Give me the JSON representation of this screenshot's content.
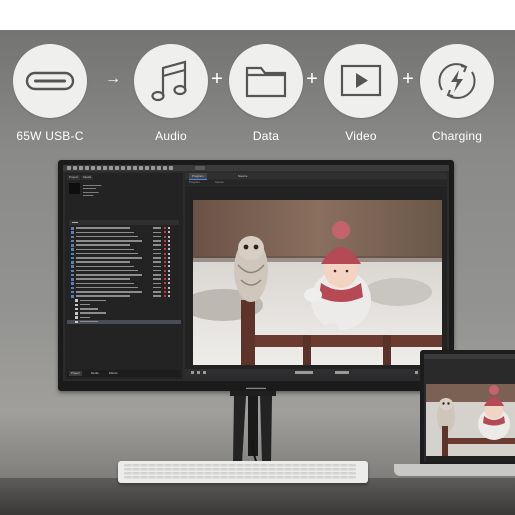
{
  "features": [
    {
      "label": "65W USB-C",
      "icon": "usb-c-port-icon"
    },
    {
      "label": "Audio",
      "icon": "music-notes-icon"
    },
    {
      "label": "Data",
      "icon": "folder-icon"
    },
    {
      "label": "Video",
      "icon": "play-icon"
    },
    {
      "label": "Charging",
      "icon": "charging-bolt-icon"
    }
  ],
  "separators": [
    "→",
    "+",
    "+",
    "+"
  ],
  "colors": {
    "icon_circle": "#efefee",
    "icon_stroke": "#555555",
    "label": "#ffffff",
    "scarf": "#b54a55"
  },
  "screen": {
    "left_tabs": [
      "Project",
      "Media"
    ],
    "footer_tabs": [
      "Project",
      "Media",
      "Effects"
    ],
    "center_tabs": [
      "Program",
      "Source"
    ],
    "sub_tabs": [
      "Program",
      "Source"
    ],
    "rows": 23
  },
  "laptop": {
    "label": "Laptop"
  }
}
